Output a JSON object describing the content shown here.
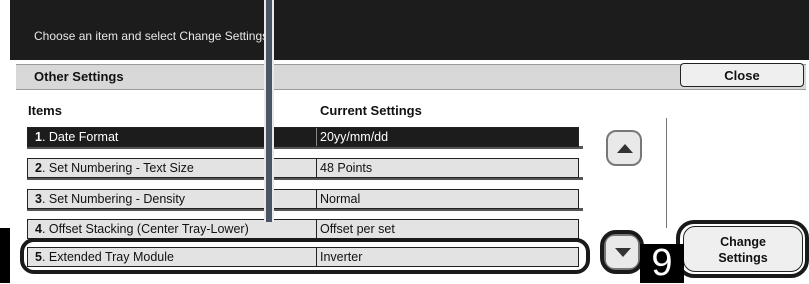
{
  "instruction": "Choose an item and select Change Settings.",
  "dialog": {
    "title": "Other Settings",
    "close_label": "Close",
    "columns": {
      "items": "Items",
      "current": "Current Settings"
    },
    "rows": [
      {
        "num": "1",
        "label": ". Date Format",
        "value": "20yy/mm/dd"
      },
      {
        "num": "2",
        "label": ". Set Numbering - Text Size",
        "value": "48 Points"
      },
      {
        "num": "3",
        "label": ". Set Numbering - Density",
        "value": "Normal"
      },
      {
        "num": "4",
        "label": ". Offset Stacking (Center Tray-Lower)",
        "value": "Offset per set"
      },
      {
        "num": "5",
        "label": ". Extended Tray Module",
        "value": "Inverter"
      }
    ],
    "change_label_1": "Change",
    "change_label_2": "Settings"
  },
  "callout_number": "9",
  "icons": {
    "scroll_up": "triangle-up-icon",
    "scroll_down": "triangle-down-icon"
  }
}
